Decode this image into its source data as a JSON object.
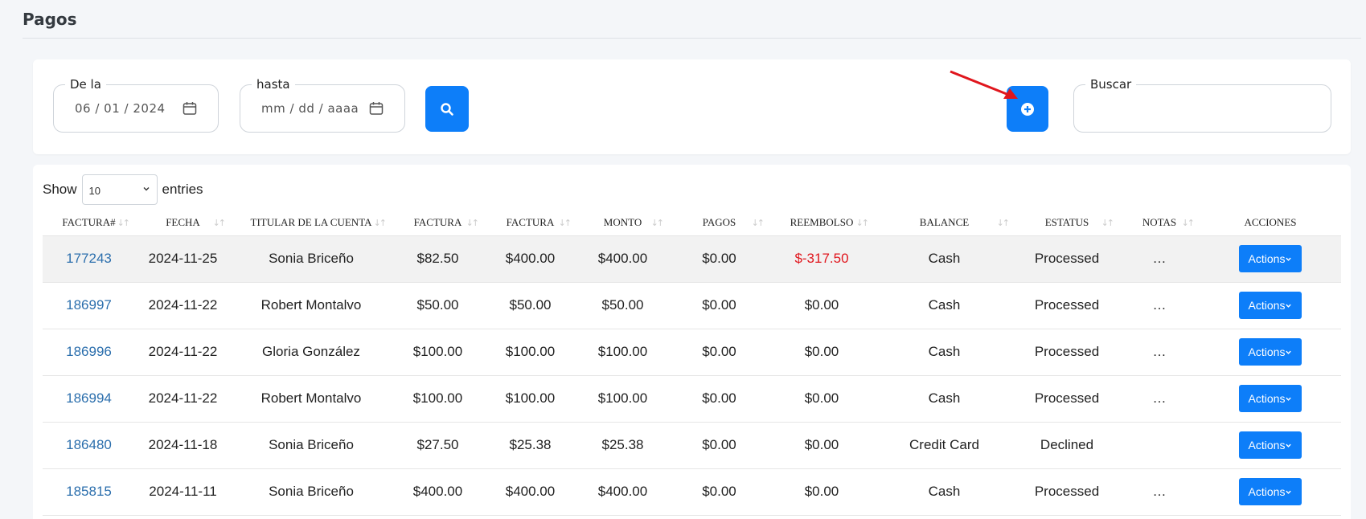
{
  "page": {
    "title": "Pagos"
  },
  "filters": {
    "from_label": "De la",
    "from_value": "06 / 01 / 2024",
    "to_label": "hasta",
    "to_value": "mm / dd / aaaa",
    "search_label": "Buscar",
    "search_value": ""
  },
  "table": {
    "show_label": "Show",
    "entries_label": "entries",
    "page_size": "10",
    "columns": [
      "FACTURA#",
      "FECHA",
      "TITULAR DE LA CUENTA",
      "FACTURA",
      "FACTURA",
      "MONTO",
      "PAGOS",
      "REEMBOLSO",
      "BALANCE",
      "ESTATUS",
      "NOTAS",
      "ACCIONES"
    ],
    "rows": [
      {
        "factura": "177243",
        "fecha": "2024-11-25",
        "titular": "Sonia Briceño",
        "factura1": "$82.50",
        "factura2": "$400.00",
        "monto": "$400.00",
        "pagos": "$0.00",
        "reembolso": "$-317.50",
        "balance": "Cash",
        "estatus": "Processed",
        "notas": "…",
        "action": "Actions"
      },
      {
        "factura": "186997",
        "fecha": "2024-11-22",
        "titular": "Robert Montalvo",
        "factura1": "$50.00",
        "factura2": "$50.00",
        "monto": "$50.00",
        "pagos": "$0.00",
        "reembolso": "$0.00",
        "balance": "Cash",
        "estatus": "Processed",
        "notas": "…",
        "action": "Actions"
      },
      {
        "factura": "186996",
        "fecha": "2024-11-22",
        "titular": "Gloria González",
        "factura1": "$100.00",
        "factura2": "$100.00",
        "monto": "$100.00",
        "pagos": "$0.00",
        "reembolso": "$0.00",
        "balance": "Cash",
        "estatus": "Processed",
        "notas": "…",
        "action": "Actions"
      },
      {
        "factura": "186994",
        "fecha": "2024-11-22",
        "titular": "Robert Montalvo",
        "factura1": "$100.00",
        "factura2": "$100.00",
        "monto": "$100.00",
        "pagos": "$0.00",
        "reembolso": "$0.00",
        "balance": "Cash",
        "estatus": "Processed",
        "notas": "…",
        "action": "Actions"
      },
      {
        "factura": "186480",
        "fecha": "2024-11-18",
        "titular": "Sonia Briceño",
        "factura1": "$27.50",
        "factura2": "$25.38",
        "monto": "$25.38",
        "pagos": "$0.00",
        "reembolso": "$0.00",
        "balance": "Credit Card",
        "estatus": "Declined",
        "notas": "",
        "action": "Actions"
      },
      {
        "factura": "185815",
        "fecha": "2024-11-11",
        "titular": "Sonia Briceño",
        "factura1": "$400.00",
        "factura2": "$400.00",
        "monto": "$400.00",
        "pagos": "$0.00",
        "reembolso": "$0.00",
        "balance": "Cash",
        "estatus": "Processed",
        "notas": "…",
        "action": "Actions"
      }
    ]
  },
  "colors": {
    "primary": "#0d7ef9",
    "link": "#2c6fad",
    "negative": "#e0161d",
    "arrow": "#e0161d"
  }
}
